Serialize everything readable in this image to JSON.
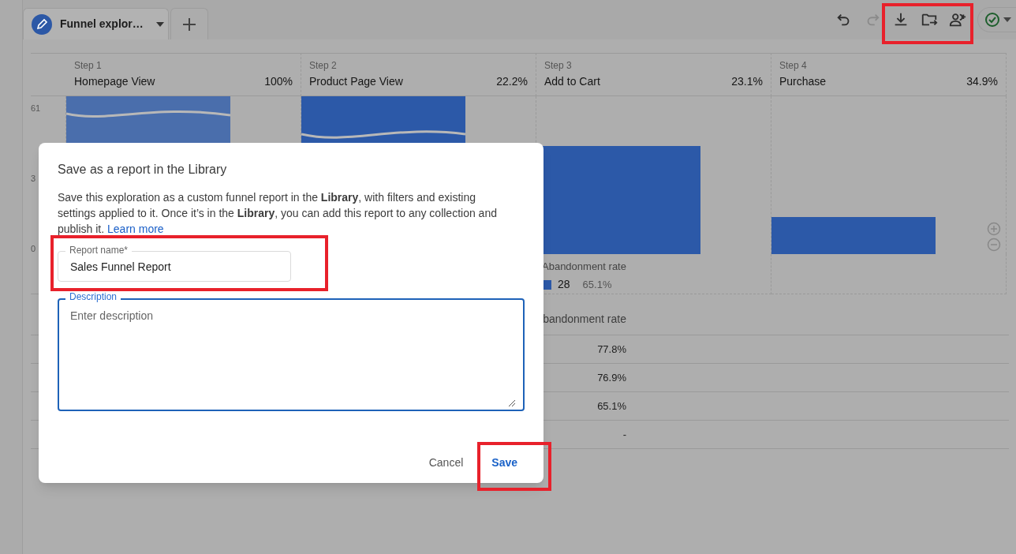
{
  "tab": {
    "label": "Funnel explor…",
    "selected": true
  },
  "toolbar": [
    {
      "kind": "undo",
      "disabled": false
    },
    {
      "kind": "redo",
      "disabled": true
    },
    {
      "kind": "download",
      "disabled": false
    },
    {
      "kind": "move-folder",
      "disabled": false
    },
    {
      "kind": "share-people",
      "disabled": false
    }
  ],
  "steps": [
    {
      "step": "Step 1",
      "name": "Homepage View",
      "percent": "100%"
    },
    {
      "step": "Step 2",
      "name": "Product Page View",
      "percent": "22.2%"
    },
    {
      "step": "Step 3",
      "name": "Add to Cart",
      "percent": "23.1%"
    },
    {
      "step": "Step 4",
      "name": "Purchase",
      "percent": "34.9%"
    }
  ],
  "axis_labels": [
    "61",
    "3",
    "0"
  ],
  "abandonment": {
    "label": "Abandonment rate",
    "count": "28",
    "rate": "65.1%"
  },
  "table": {
    "column_header": "bandonment rate",
    "rows": [
      "77.8%",
      "76.9%",
      "65.1%",
      "-"
    ]
  },
  "dialog": {
    "title": "Save as a report in the Library",
    "body": "Save this exploration as a custom funnel report in the **Library**, with filters and existing settings applied to it. Once it’s in the **Library**, you can add this report to any collection and publish it.",
    "link": "Learn more",
    "report_name": {
      "label": "Report name*",
      "value": "Sales Funnel Report"
    },
    "description": {
      "label": "Description",
      "placeholder": "Enter description",
      "focused": true
    },
    "buttons": [
      {
        "kind": "cancel",
        "label": "Cancel"
      },
      {
        "kind": "save",
        "label": "Save"
      }
    ]
  }
}
